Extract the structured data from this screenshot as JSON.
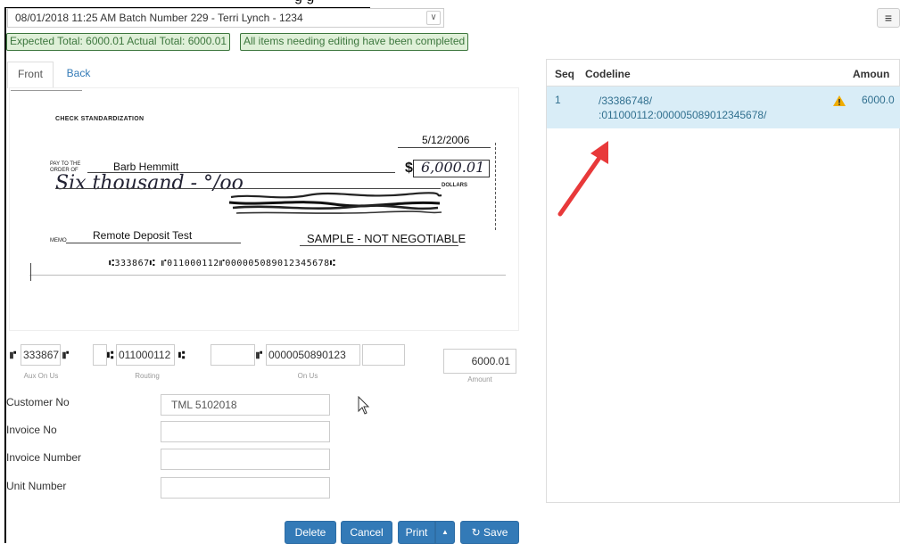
{
  "top_caption": "g        g",
  "batch": {
    "selected": "08/01/2018 11:25 AM Batch Number 229 - Terri Lynch - 1234"
  },
  "status": {
    "totals": "Expected Total: 6000.01 Actual Total: 6000.01",
    "editing": "All items needing editing have been completed"
  },
  "tabs": [
    {
      "label": "Front"
    },
    {
      "label": "Back"
    }
  ],
  "check": {
    "title": "CHECK STANDARDIZATION",
    "date": "5/12/2006",
    "pay_to": "PAY TO THE ORDER OF",
    "payee": "Barb Hemmitt",
    "dollar_sign": "$",
    "amount_handwritten": "6,000.01",
    "written_amount": "Six thousand - °/oo",
    "dollars": "DOLLARS",
    "memo_label": "MEMO",
    "memo": "Remote Deposit Test",
    "sample": "SAMPLE - NOT NEGOTIABLE",
    "micr": "⑆333867⑆ ⑈011000112⑈000005089012345678⑆"
  },
  "micr_fields": {
    "aux_on_us": "333867",
    "routing": "011000112",
    "on_us": "0000050890123",
    "amount": "6000.01",
    "captions": {
      "aux_on_us": "Aux On Us",
      "routing": "Routing",
      "on_us": "On Us",
      "amount": "Amount"
    }
  },
  "form": {
    "customer_no_label": "Customer No",
    "customer_no_value": "TML 5102018",
    "invoice_no_label": "Invoice No",
    "invoice_number_label": "Invoice Number",
    "unit_number_label": "Unit Number"
  },
  "buttons": {
    "delete": "Delete",
    "cancel": "Cancel",
    "print": "Print",
    "print_caret": "▲",
    "save": "↻ Save"
  },
  "menu_icon": "≡",
  "dropdown_icon": "∨",
  "table": {
    "columns": [
      "Seq",
      "Codeline",
      "Amoun"
    ],
    "rows": [
      {
        "seq": "1",
        "codeline_1": "/33386748/",
        "codeline_2": ":011000112:000005089012345678/",
        "amount": "6000.0"
      }
    ]
  },
  "colors": {
    "primary_button": "#337ab7",
    "success_bg": "#dff0d8",
    "success_text": "#3c763d",
    "selected_row": "#d9edf7",
    "arrow": "#e8393a",
    "warning": "#f0ad00"
  }
}
